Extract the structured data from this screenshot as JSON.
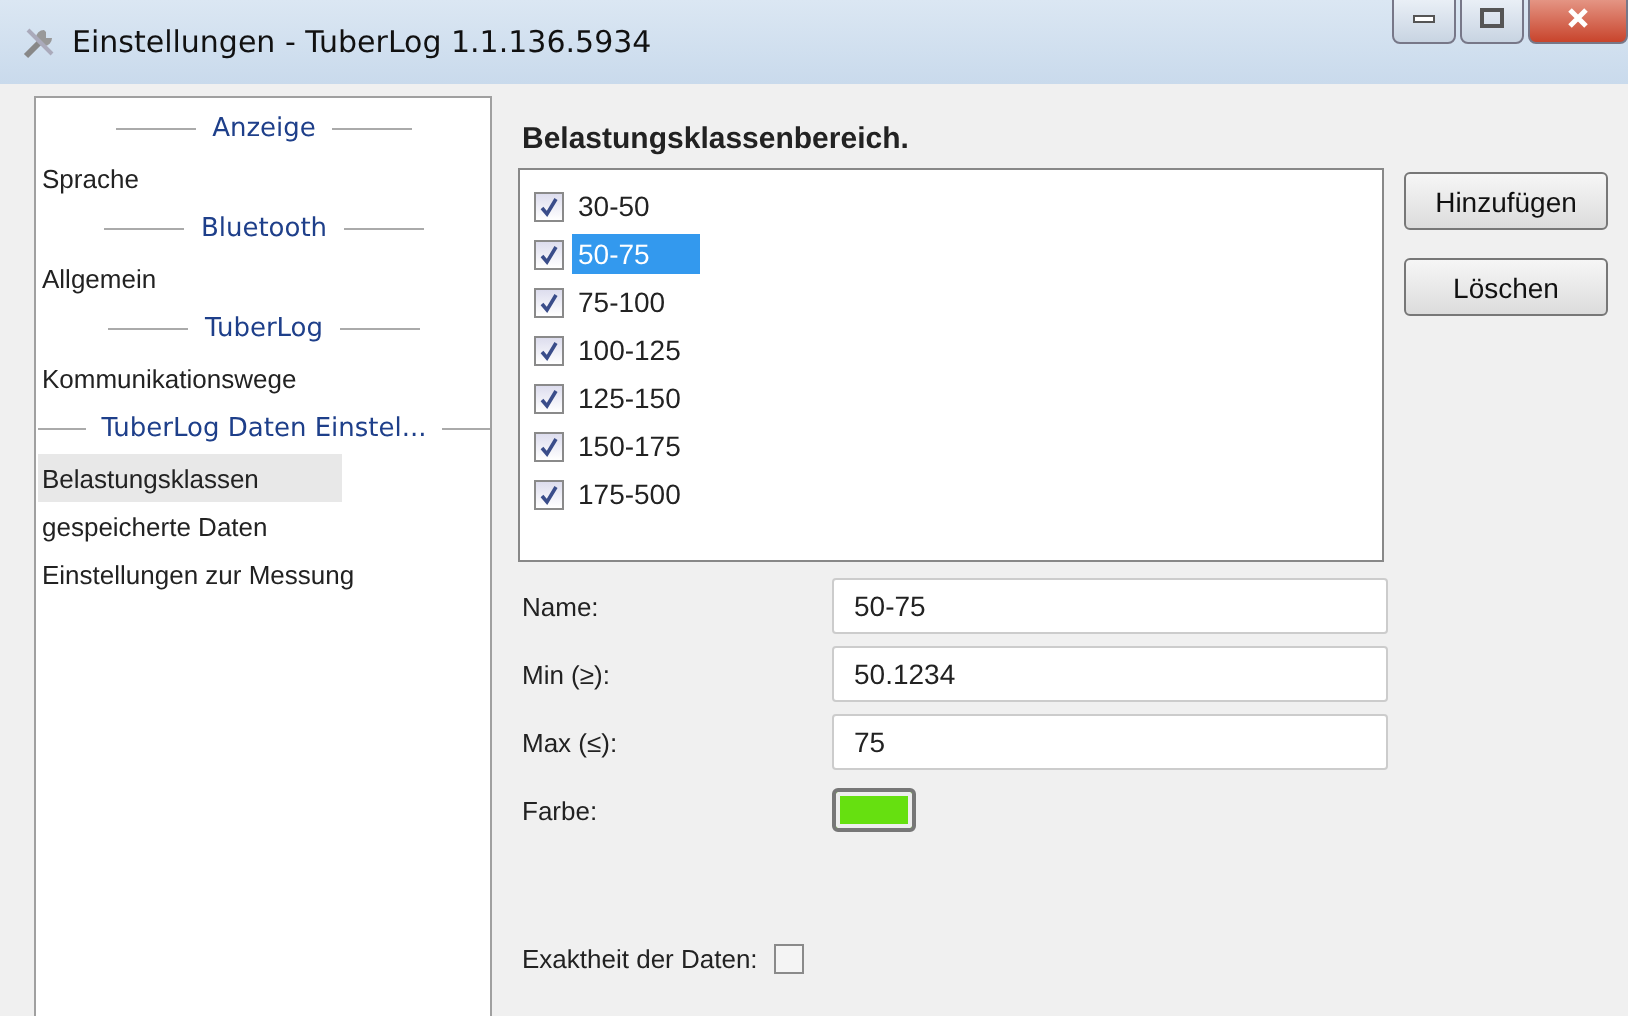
{
  "window": {
    "title": "Einstellungen - TuberLog 1.1.136.5934"
  },
  "sidebar": {
    "items": [
      {
        "kind": "header",
        "label": "Anzeige",
        "selected": false
      },
      {
        "kind": "item",
        "label": "Sprache",
        "selected": false
      },
      {
        "kind": "header",
        "label": "Bluetooth",
        "selected": false
      },
      {
        "kind": "item",
        "label": "Allgemein",
        "selected": false
      },
      {
        "kind": "header",
        "label": "TuberLog",
        "selected": false
      },
      {
        "kind": "item",
        "label": "Kommunikationswege",
        "selected": false
      },
      {
        "kind": "header",
        "label": "TuberLog Daten Einstel...",
        "selected": false
      },
      {
        "kind": "item",
        "label": "Belastungsklassen",
        "selected": true
      },
      {
        "kind": "item",
        "label": "gespeicherte Daten",
        "selected": false
      },
      {
        "kind": "item",
        "label": "Einstellungen zur Messung",
        "selected": false
      }
    ]
  },
  "heading": "Belastungsklassenbereich.",
  "classes": [
    {
      "label": "30-50",
      "checked": true,
      "selected": false
    },
    {
      "label": "50-75",
      "checked": true,
      "selected": true
    },
    {
      "label": "75-100",
      "checked": true,
      "selected": false
    },
    {
      "label": "100-125",
      "checked": true,
      "selected": false
    },
    {
      "label": "125-150",
      "checked": true,
      "selected": false
    },
    {
      "label": "150-175",
      "checked": true,
      "selected": false
    },
    {
      "label": "175-500",
      "checked": true,
      "selected": false
    }
  ],
  "buttons": [
    "Hinzufügen",
    "Löschen"
  ],
  "fields": [
    {
      "kind": "text",
      "label": "Name:",
      "value": "50-75"
    },
    {
      "kind": "text",
      "label": "Min (≥):",
      "value": "50.1234"
    },
    {
      "kind": "text",
      "label": "Max (≤):",
      "value": "75"
    },
    {
      "kind": "color",
      "label": "Farbe:",
      "color": "#66e010"
    }
  ],
  "exactness": {
    "label": "Exaktheit der Daten:",
    "checked": false
  }
}
